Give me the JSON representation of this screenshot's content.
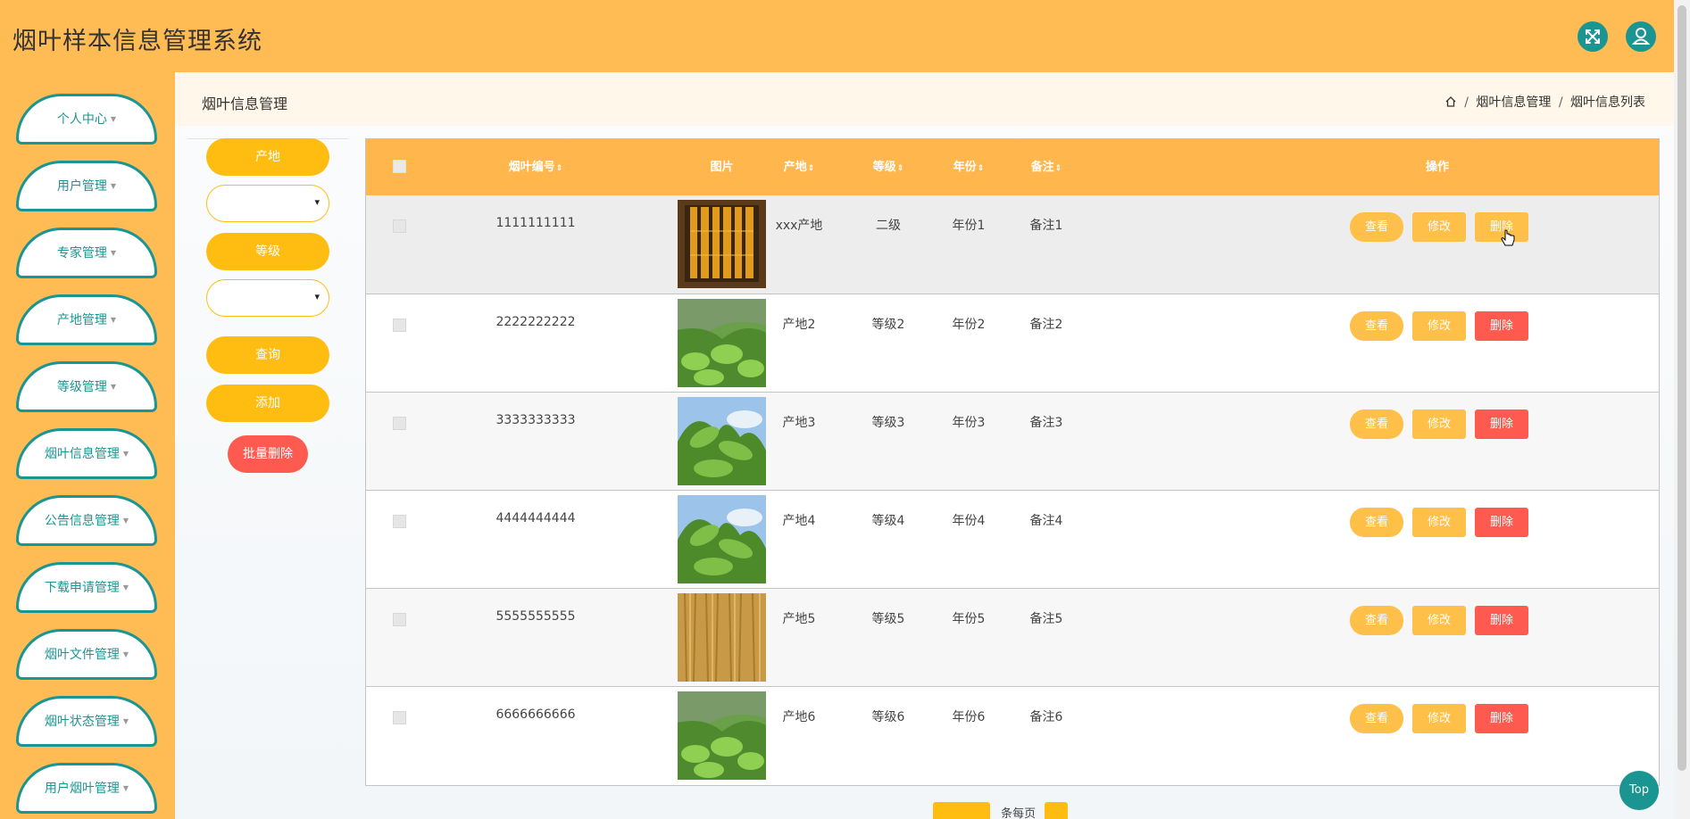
{
  "header": {
    "title": "烟叶样本信息管理系统",
    "expand_icon": "expand-icon",
    "user_icon": "user-icon"
  },
  "sidebar": {
    "items": [
      {
        "label": "个人中心"
      },
      {
        "label": "用户管理"
      },
      {
        "label": "专家管理"
      },
      {
        "label": "产地管理"
      },
      {
        "label": "等级管理"
      },
      {
        "label": "烟叶信息管理"
      },
      {
        "label": "公告信息管理"
      },
      {
        "label": "下载申请管理"
      },
      {
        "label": "烟叶文件管理"
      },
      {
        "label": "烟叶状态管理"
      },
      {
        "label": "用户烟叶管理"
      }
    ]
  },
  "page": {
    "title": "烟叶信息管理",
    "breadcrumb": {
      "home_icon": "home-icon",
      "sep": "/",
      "level1": "烟叶信息管理",
      "level2": "烟叶信息列表"
    }
  },
  "filters": {
    "origin_label": "产地",
    "grade_label": "等级",
    "origin_value": "",
    "grade_value": "",
    "search_label": "查询",
    "add_label": "添加",
    "batch_delete_label": "批量删除"
  },
  "table": {
    "headers": {
      "code": "烟叶编号",
      "image": "图片",
      "origin": "产地",
      "grade": "等级",
      "year": "年份",
      "remark": "备注",
      "action": "操作",
      "sort_glyph": "⇕"
    },
    "action_labels": {
      "view": "查看",
      "edit": "修改",
      "delete": "删除"
    },
    "rows": [
      {
        "code": "1111111111",
        "origin": "xxx产地",
        "grade": "二级",
        "year": "年份1",
        "remark": "备注1",
        "image": "curing-leaves"
      },
      {
        "code": "2222222222",
        "origin": "产地2",
        "grade": "等级2",
        "year": "年份2",
        "remark": "备注2",
        "image": "tobacco-field"
      },
      {
        "code": "3333333333",
        "origin": "产地3",
        "grade": "等级3",
        "year": "年份3",
        "remark": "备注3",
        "image": "tobacco-plant-sky"
      },
      {
        "code": "4444444444",
        "origin": "产地4",
        "grade": "等级4",
        "year": "年份4",
        "remark": "备注4",
        "image": "tobacco-plant-sky"
      },
      {
        "code": "5555555555",
        "origin": "产地5",
        "grade": "等级5",
        "year": "年份5",
        "remark": "备注5",
        "image": "dried-leaves"
      },
      {
        "code": "6666666666",
        "origin": "产地6",
        "grade": "等级6",
        "year": "年份6",
        "remark": "备注6",
        "image": "tobacco-field"
      }
    ]
  },
  "pagination": {
    "per_page_text": "条每页"
  },
  "top_button": {
    "label": "Top"
  },
  "colors": {
    "accent": "#ffbc55",
    "teal": "#1a9591",
    "danger": "#ff5a4f",
    "button": "#ffbd12"
  }
}
